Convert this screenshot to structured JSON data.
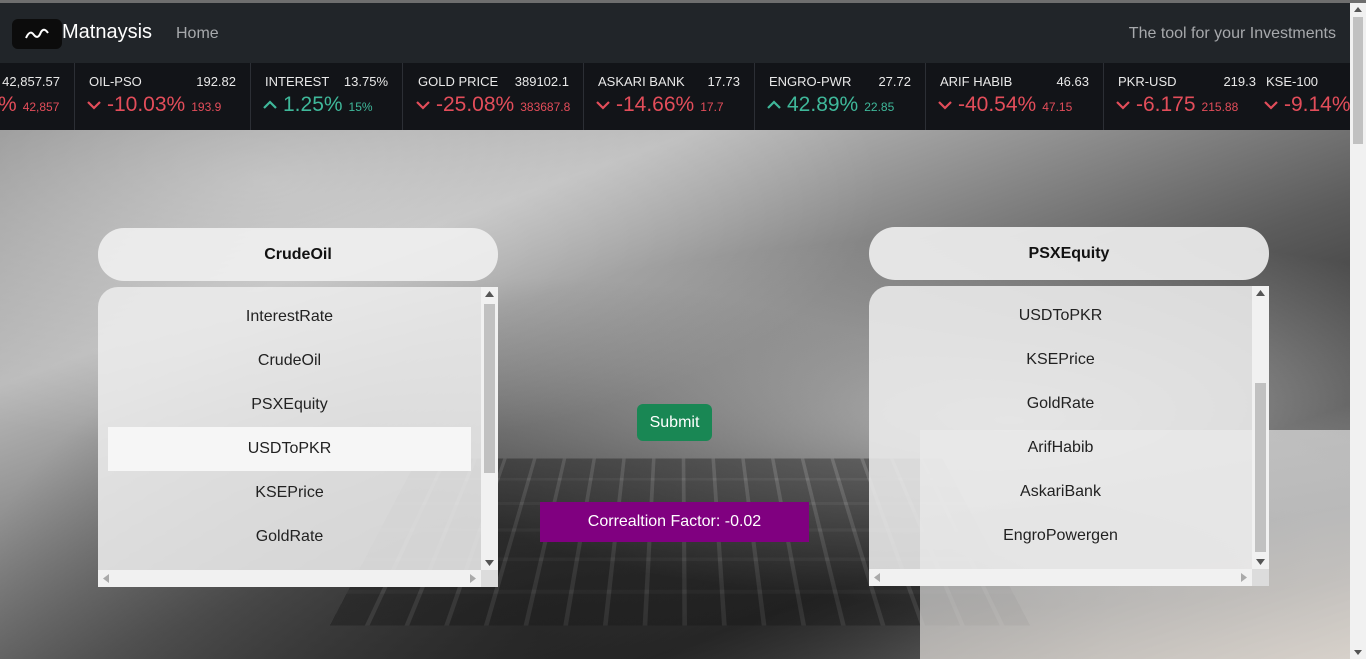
{
  "navbar": {
    "brand": "Matnaysis",
    "home": "Home",
    "tagline": "The tool for your Investments"
  },
  "ticker": [
    {
      "name": "",
      "price": "42,857.57",
      "change": "%",
      "prev": "42,857",
      "dir": "down",
      "show_arrow": false
    },
    {
      "name": "OIL-PSO",
      "price": "192.82",
      "change": "-10.03%",
      "prev": "193.9",
      "dir": "down",
      "show_arrow": true
    },
    {
      "name": "INTEREST",
      "price": "13.75%",
      "change": "1.25%",
      "prev": "15%",
      "dir": "up",
      "show_arrow": true
    },
    {
      "name": "GOLD PRICE",
      "price": "389102.1",
      "change": "-25.08%",
      "prev": "383687.8",
      "dir": "down",
      "show_arrow": true
    },
    {
      "name": "ASKARI BANK",
      "price": "17.73",
      "change": "-14.66%",
      "prev": "17.7",
      "dir": "down",
      "show_arrow": true
    },
    {
      "name": "ENGRO-PWR",
      "price": "27.72",
      "change": "42.89%",
      "prev": "22.85",
      "dir": "up",
      "show_arrow": true
    },
    {
      "name": "ARIF HABIB",
      "price": "46.63",
      "change": "-40.54%",
      "prev": "47.15",
      "dir": "down",
      "show_arrow": true
    },
    {
      "name": "PKR-USD",
      "price": "219.3",
      "change": "-6.175",
      "prev": "215.88",
      "dir": "down",
      "show_arrow": true
    },
    {
      "name": "KSE-100",
      "price": "",
      "change": "-9.14%",
      "prev": "",
      "dir": "down",
      "show_arrow": true
    }
  ],
  "left_select": {
    "header": "CrudeOil",
    "items": [
      "InterestRate",
      "CrudeOil",
      "PSXEquity",
      "USDToPKR",
      "KSEPrice",
      "GoldRate"
    ],
    "highlighted": "USDToPKR"
  },
  "right_select": {
    "header": "PSXEquity",
    "items": [
      "USDToPKR",
      "KSEPrice",
      "GoldRate",
      "ArifHabib",
      "AskariBank",
      "EngroPowergen"
    ]
  },
  "submit_label": "Submit",
  "correlation_text": "Correaltion Factor: -0.02",
  "colors": {
    "navbar": "#212529",
    "ticker_bg": "#121418",
    "down": "#e34d5a",
    "up": "#3fb89a",
    "submit": "#198754",
    "correlation_bg": "#800080"
  }
}
